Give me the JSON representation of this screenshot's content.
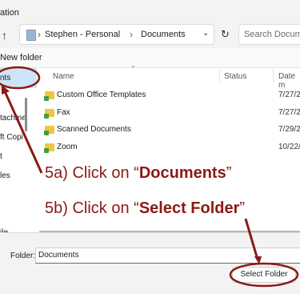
{
  "window": {
    "title": "ation"
  },
  "address_bar": {
    "crumbs": [
      "Stephen - Personal",
      "Documents"
    ],
    "search_placeholder": "Search Documen"
  },
  "command_bar": {
    "new_folder_label": "New folder"
  },
  "nav_pane": {
    "selected_item": "nts",
    "items": [
      "tachme",
      "ft Copi",
      "t",
      "les",
      "ile"
    ]
  },
  "columns": {
    "name_header": "Name",
    "status_header": "Status",
    "date_header": "Date m"
  },
  "files": [
    {
      "name": "Custom Office Templates",
      "date": "7/27/2"
    },
    {
      "name": "Fax",
      "date": "7/27/2"
    },
    {
      "name": "Scanned Documents",
      "date": "7/29/2"
    },
    {
      "name": "Zoom",
      "date": "10/22/"
    }
  ],
  "footer": {
    "folder_label": "Folder:",
    "folder_value": "Documents",
    "select_button": "Select Folder"
  },
  "annotations": {
    "step_a_prefix": "5a)  Click on “",
    "step_a_bold": "Documents",
    "step_a_suffix": "”",
    "step_b_prefix": "5b)  Click on “",
    "step_b_bold": "Select Folder",
    "step_b_suffix": "”",
    "color": "#8b1a14"
  },
  "icons": {
    "up": "up-arrow-icon",
    "dropdown": "chevron-down-icon",
    "refresh": "refresh-icon",
    "folder": "folder-icon",
    "location": "location-folder-icon"
  }
}
